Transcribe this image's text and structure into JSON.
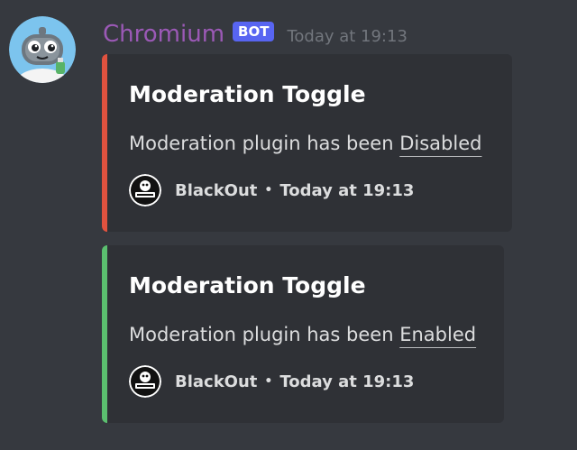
{
  "message": {
    "author": {
      "username": "Chromium",
      "username_color": "#9b59b6",
      "bot_tag": "BOT",
      "avatar_icon": "robot-avatar-icon"
    },
    "timestamp": "Today at 19:13",
    "embeds": [
      {
        "accent_color": "#e74c3c",
        "title": "Moderation Toggle",
        "description_prefix": "Moderation plugin has been",
        "status": "Disabled",
        "footer": {
          "icon": "blackout-logo-icon",
          "author": "BlackOut",
          "separator": "•",
          "time": "Today at 19:13"
        }
      },
      {
        "accent_color": "#43b581",
        "title": "Moderation Toggle",
        "description_prefix": "Moderation plugin has been",
        "status": "Enabled",
        "footer": {
          "icon": "blackout-logo-icon",
          "author": "BlackOut",
          "separator": "•",
          "time": "Today at 19:13"
        }
      }
    ]
  },
  "colors": {
    "background": "#36393f",
    "embed_background": "#2f3136",
    "bot_tag": "#5865f2",
    "timestamp": "#72767d"
  }
}
